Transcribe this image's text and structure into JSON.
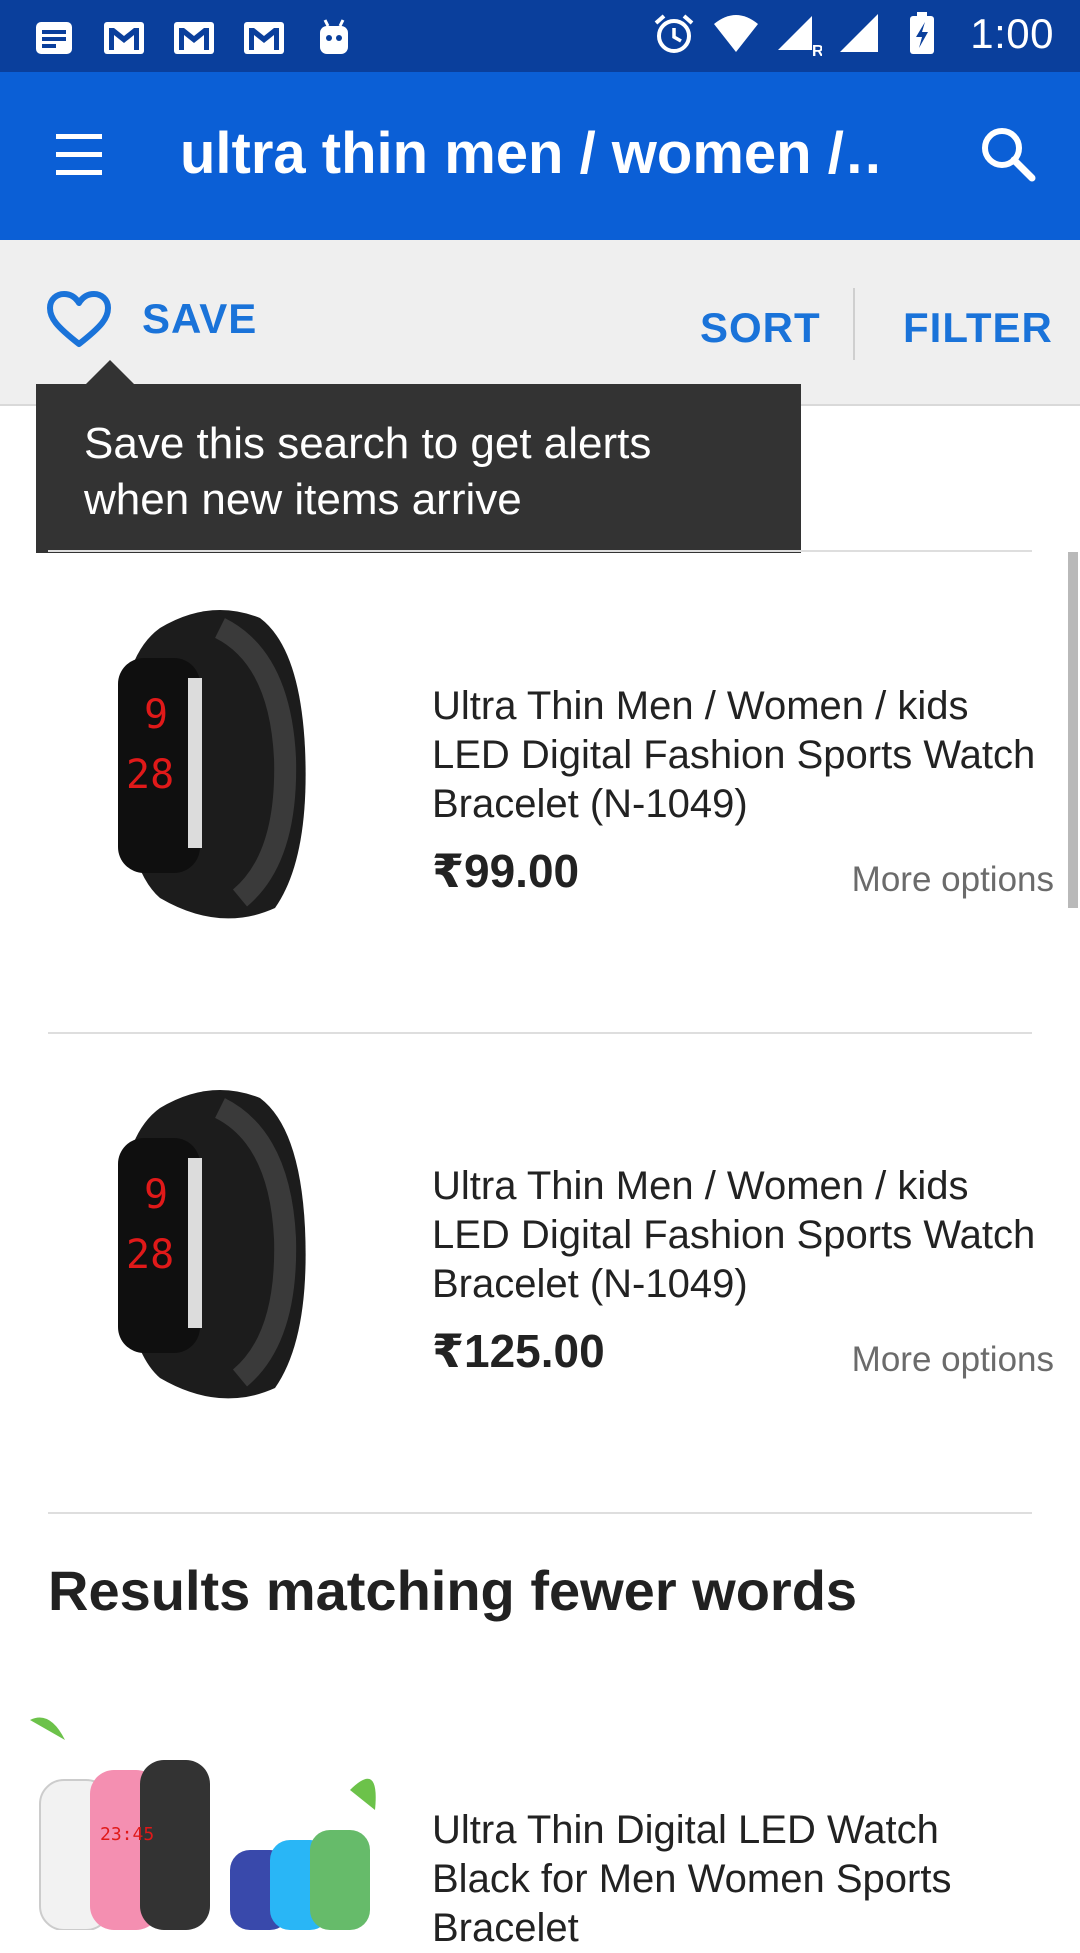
{
  "status_bar": {
    "time": "1:00",
    "left_icons": [
      "notes-icon",
      "gmail-icon",
      "gmail-icon",
      "gmail-icon",
      "android-icon"
    ],
    "right_icons": [
      "alarm-icon",
      "wifi-icon",
      "signal-roaming-icon",
      "signal-icon",
      "battery-charging-icon"
    ]
  },
  "app_bar": {
    "title": "ultra thin men / women /…",
    "menu_icon": "hamburger-menu-icon",
    "search_icon": "search-icon",
    "color": "#0b5fd6"
  },
  "actions": {
    "save_label": "SAVE",
    "sort_label": "SORT",
    "filter_label": "FILTER",
    "accent": "#1a73d9"
  },
  "tooltip": {
    "text_line1": "Save this search to get alerts",
    "text_line2": "when new items arrive"
  },
  "items": [
    {
      "title_line1": "Ultra Thin Men / Women / kids",
      "title_line2": "LED Digital Fashion Sports Watch",
      "title_line3": "Bracelet (N-1049)",
      "price": "₹99.00",
      "more": "More options"
    },
    {
      "title_line1": "Ultra Thin Men / Women / kids",
      "title_line2": "LED Digital Fashion Sports Watch",
      "title_line3": "Bracelet (N-1049)",
      "price": "₹125.00",
      "more": "More options"
    }
  ],
  "fewer_words": {
    "heading": "Results matching fewer words",
    "item": {
      "title_line1": "Ultra Thin Digital LED Watch",
      "title_line2": "Black for Men Women Sports",
      "title_line3": "Bracelet"
    }
  }
}
